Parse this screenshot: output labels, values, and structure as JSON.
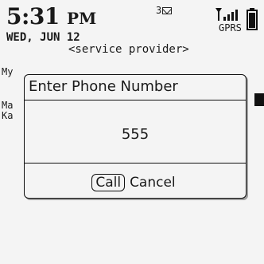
{
  "status": {
    "time": "5:31",
    "ampm": "PM",
    "date": "WED, JUN 12",
    "provider": "<service provider>",
    "message_count": "3",
    "network": "GPRS",
    "signal_icon": "signal-bars-icon",
    "battery_icon": "battery-icon"
  },
  "background_list": {
    "rows": [
      "My",
      "Ma",
      "Ka"
    ]
  },
  "dialog": {
    "title": "Enter Phone Number",
    "value": "555",
    "call_label": "Call",
    "cancel_label": "Cancel"
  }
}
